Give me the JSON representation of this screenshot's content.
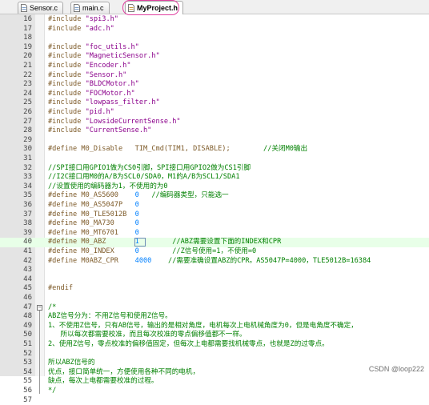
{
  "tabs": [
    {
      "label": "Sensor.c",
      "active": false
    },
    {
      "label": "main.c",
      "active": false
    },
    {
      "label": "MyProject.h",
      "active": true
    }
  ],
  "lines": [
    {
      "n": "16",
      "code": [
        {
          "t": "#include ",
          "c": "pp"
        },
        {
          "t": "\"spi3.h\"",
          "c": "str"
        }
      ]
    },
    {
      "n": "17",
      "code": [
        {
          "t": "#include ",
          "c": "pp"
        },
        {
          "t": "\"adc.h\"",
          "c": "str"
        }
      ]
    },
    {
      "n": "18",
      "code": []
    },
    {
      "n": "19",
      "code": [
        {
          "t": "#include ",
          "c": "pp"
        },
        {
          "t": "\"foc_utils.h\"",
          "c": "str"
        }
      ]
    },
    {
      "n": "20",
      "code": [
        {
          "t": "#include ",
          "c": "pp"
        },
        {
          "t": "\"MagneticSensor.h\"",
          "c": "str"
        }
      ]
    },
    {
      "n": "21",
      "code": [
        {
          "t": "#include ",
          "c": "pp"
        },
        {
          "t": "\"Encoder.h\"",
          "c": "str"
        }
      ]
    },
    {
      "n": "22",
      "code": [
        {
          "t": "#include ",
          "c": "pp"
        },
        {
          "t": "\"Sensor.h\"",
          "c": "str"
        }
      ]
    },
    {
      "n": "23",
      "code": [
        {
          "t": "#include ",
          "c": "pp"
        },
        {
          "t": "\"BLDCMotor.h\"",
          "c": "str"
        }
      ]
    },
    {
      "n": "24",
      "code": [
        {
          "t": "#include ",
          "c": "pp"
        },
        {
          "t": "\"FOCMotor.h\"",
          "c": "str"
        }
      ]
    },
    {
      "n": "25",
      "code": [
        {
          "t": "#include ",
          "c": "pp"
        },
        {
          "t": "\"lowpass_filter.h\"",
          "c": "str"
        }
      ]
    },
    {
      "n": "26",
      "code": [
        {
          "t": "#include ",
          "c": "pp"
        },
        {
          "t": "\"pid.h\"",
          "c": "str"
        }
      ]
    },
    {
      "n": "27",
      "code": [
        {
          "t": "#include ",
          "c": "pp"
        },
        {
          "t": "\"LowsideCurrentSense.h\"",
          "c": "str"
        }
      ]
    },
    {
      "n": "28",
      "code": [
        {
          "t": "#include ",
          "c": "pp"
        },
        {
          "t": "\"CurrentSense.h\"",
          "c": "str"
        }
      ]
    },
    {
      "n": "29",
      "code": []
    },
    {
      "n": "30",
      "code": [
        {
          "t": "#define M0_Disable   TIM_Cmd(TIM1, DISABLE);        ",
          "c": "pp"
        },
        {
          "t": "//关闭M0输出",
          "c": "cmt"
        }
      ]
    },
    {
      "n": "31",
      "code": []
    },
    {
      "n": "32",
      "code": [
        {
          "t": "//SPI接口用GPIO1做为CS0引脚，SPI接口用GPIO2做为CS1引脚",
          "c": "cmt"
        }
      ]
    },
    {
      "n": "33",
      "code": [
        {
          "t": "//I2C接口用M0的A/B为SCL0/SDA0，M1的A/B为SCL1/SDA1",
          "c": "cmt"
        }
      ]
    },
    {
      "n": "34",
      "code": [
        {
          "t": "//设置使用的编码器为1，不使用的为0",
          "c": "cmt"
        }
      ]
    },
    {
      "n": "35",
      "code": [
        {
          "t": "#define M0_AS5600    ",
          "c": "pp"
        },
        {
          "t": "0",
          "c": "num"
        },
        {
          "t": "   //编码器类型，只能选一",
          "c": "cmt"
        }
      ]
    },
    {
      "n": "36",
      "code": [
        {
          "t": "#define M0_AS5047P   ",
          "c": "pp"
        },
        {
          "t": "0",
          "c": "num"
        }
      ]
    },
    {
      "n": "37",
      "code": [
        {
          "t": "#define M0_TLE5012B  ",
          "c": "pp"
        },
        {
          "t": "0",
          "c": "num"
        }
      ]
    },
    {
      "n": "38",
      "code": [
        {
          "t": "#define M0_MA730     ",
          "c": "pp"
        },
        {
          "t": "0",
          "c": "num"
        }
      ]
    },
    {
      "n": "39",
      "code": [
        {
          "t": "#define M0_MT6701    ",
          "c": "pp"
        },
        {
          "t": "0",
          "c": "num"
        }
      ]
    },
    {
      "n": "40",
      "code": [
        {
          "t": "#define M0_ABZ       ",
          "c": "pp"
        },
        {
          "t": "1",
          "c": "num"
        },
        {
          "t": "        //ABZ需要设置下面的INDEX和CPR",
          "c": "cmt"
        }
      ],
      "current": true
    },
    {
      "n": "41",
      "code": [
        {
          "t": "#define M0_INDEX     ",
          "c": "pp"
        },
        {
          "t": "0",
          "c": "num"
        },
        {
          "t": "        //Z信号使用=1，不使用=0",
          "c": "cmt"
        }
      ]
    },
    {
      "n": "42",
      "code": [
        {
          "t": "#define M0ABZ_CPR    ",
          "c": "pp"
        },
        {
          "t": "4000",
          "c": "num"
        },
        {
          "t": "    //需要准确设置ABZ的CPR。AS5047P=4000，TLE5012B=16384",
          "c": "cmt"
        }
      ]
    },
    {
      "n": "43",
      "code": []
    },
    {
      "n": "44",
      "code": []
    },
    {
      "n": "45",
      "code": [
        {
          "t": "#endif",
          "c": "pp"
        }
      ]
    },
    {
      "n": "46",
      "code": []
    },
    {
      "n": "47",
      "code": [
        {
          "t": "/*",
          "c": "cmt"
        }
      ],
      "fold": true
    },
    {
      "n": "48",
      "code": [
        {
          "t": "ABZ信号分为：不用Z信号和使用Z信号。",
          "c": "cmt"
        }
      ]
    },
    {
      "n": "49",
      "code": [
        {
          "t": "1、不使用Z信号，只有AB信号，输出的是相对角度，电机每次上电机械角度为0，但是电角度不确定，",
          "c": "cmt"
        }
      ]
    },
    {
      "n": "50",
      "code": [
        {
          "t": "   所以每次都需要校准，而且每次校准的零点偏移值都不一样。",
          "c": "cmt"
        }
      ]
    },
    {
      "n": "51",
      "code": [
        {
          "t": "2、使用Z信号，零点校准的偏移值固定，但每次上电都需要找机械零点，也就是Z的过零点。",
          "c": "cmt"
        }
      ]
    },
    {
      "n": "52",
      "code": []
    },
    {
      "n": "53",
      "code": [
        {
          "t": "所以ABZ信号的",
          "c": "cmt"
        }
      ]
    },
    {
      "n": "54",
      "code": [
        {
          "t": "优点，接口简单统一，方便使用各种不同的电机，",
          "c": "cmt"
        }
      ]
    },
    {
      "n": "55",
      "code": [
        {
          "t": "缺点，每次上电都需要校准的过程。",
          "c": "cmt"
        }
      ]
    },
    {
      "n": "56",
      "code": [
        {
          "t": "*/",
          "c": "cmt"
        }
      ]
    },
    {
      "n": "57",
      "code": []
    }
  ],
  "watermark": "CSDN @loop222",
  "colors": {
    "preprocessor": "#7d5a28",
    "string": "#8b008b",
    "number": "#0080ff",
    "comment": "#008000",
    "current_line": "#e8ffe8",
    "tab_highlight_ring": "#e040a0"
  }
}
